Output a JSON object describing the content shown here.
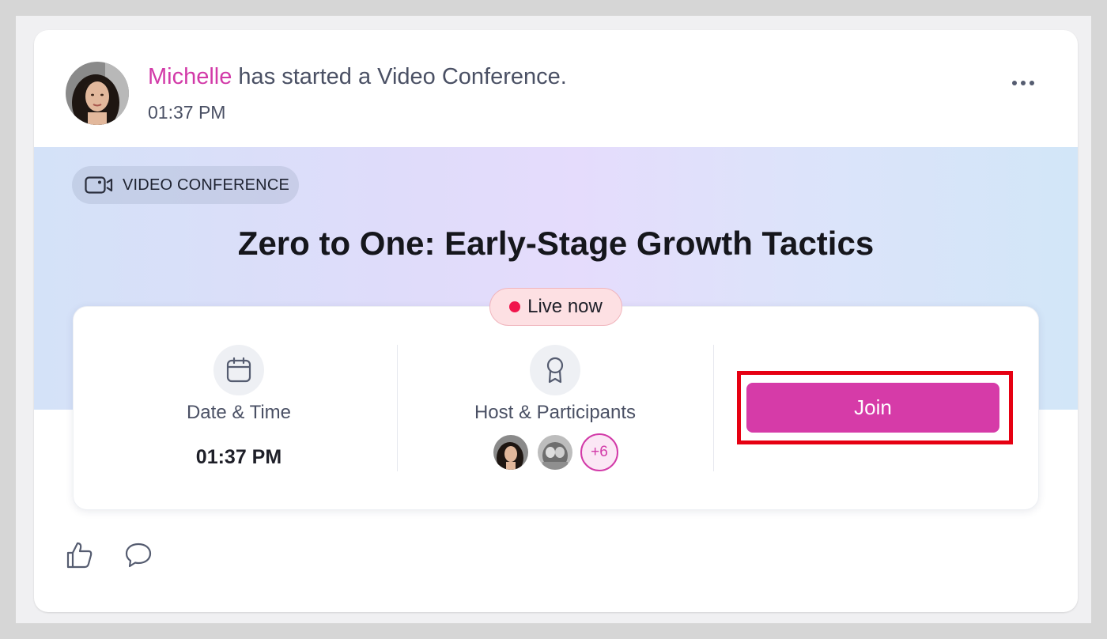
{
  "post": {
    "author": "Michelle",
    "action_text": " has started a Video Conference.",
    "time": "01:37 PM"
  },
  "banner": {
    "tag_label": "VIDEO CONFERENCE",
    "title": "Zero to One: Early-Stage Growth Tactics"
  },
  "status": {
    "live_label": "Live now"
  },
  "details": {
    "date_label": "Date & Time",
    "date_value": "01:37 PM",
    "host_label": "Host & Participants",
    "extra_participants": "+6"
  },
  "join": {
    "label": "Join"
  },
  "colors": {
    "accent": "#d63ba8",
    "live_dot": "#f0154c",
    "highlight": "#e60012"
  },
  "icons": {
    "video": "video-camera-icon",
    "calendar": "calendar-icon",
    "host": "award-icon",
    "like": "thumbs-up-icon",
    "comment": "comment-icon",
    "more": "more-horizontal-icon"
  }
}
